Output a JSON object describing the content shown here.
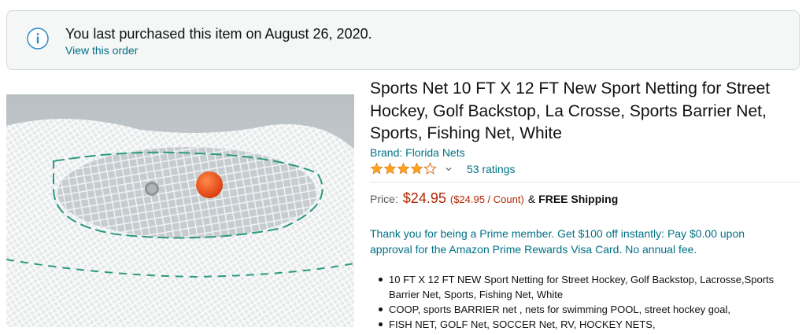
{
  "notice": {
    "message": "You last purchased this item on August 26, 2020.",
    "link": "View this order",
    "icon": "info-icon"
  },
  "product": {
    "title": "Sports Net 10 FT X 12 FT New Sport Netting for Street Hockey, Golf Backstop, La Crosse, Sports Barrier Net, Sports, Fishing Net, White",
    "brand": "Brand: Florida Nets",
    "rating": {
      "stars": 4,
      "ratings_label": "53 ratings"
    },
    "price": {
      "label": "Price:",
      "value": "$24.95",
      "unit": "($24.95 / Count)",
      "amp": "&",
      "shipping": "FREE Shipping"
    },
    "prime_offer": "Thank you for being a Prime member. Get $100 off instantly: Pay $0.00 upon approval for the Amazon Prime Rewards Visa Card. No annual fee.",
    "bullets": [
      "10 FT X 12 FT NEW Sport Netting for Street Hockey, Golf Backstop, Lacrosse,Sports Barrier Net, Sports, Fishing Net, White",
      "COOP, sports BARRIER net , nets for swimming POOL, street hockey goal,",
      "FISH NET, GOLF Net, SOCCER Net, RV, HOCKEY NETS,"
    ]
  },
  "colors": {
    "link": "#007185",
    "price": "#b12704",
    "star": "#ffa41c",
    "notice_bg": "#f5f6f6"
  }
}
